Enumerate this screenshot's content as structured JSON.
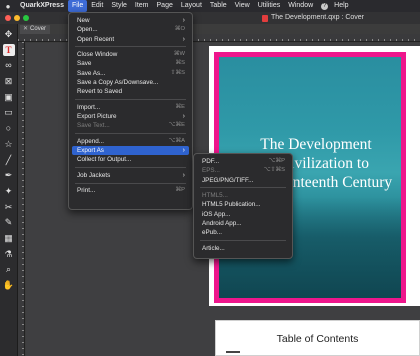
{
  "menubar": {
    "app_name": "QuarkXPress",
    "items": [
      "File",
      "Edit",
      "Style",
      "Item",
      "Page",
      "Layout",
      "Table",
      "View",
      "Utilities",
      "Window"
    ],
    "help_label": "Help"
  },
  "window": {
    "title": "The Development.qxp : Cover"
  },
  "layout_tab": {
    "label": "Cover"
  },
  "file_menu": [
    {
      "label": "New",
      "submenu": true
    },
    {
      "label": "Open...",
      "shortcut": "⌘O"
    },
    {
      "label": "Open Recent",
      "submenu": true
    },
    {
      "separator": true
    },
    {
      "label": "Close Window",
      "shortcut": "⌘W"
    },
    {
      "label": "Save",
      "shortcut": "⌘S"
    },
    {
      "label": "Save As...",
      "shortcut": "⇧⌘S"
    },
    {
      "label": "Save a Copy As/Downsave..."
    },
    {
      "label": "Revert to Saved"
    },
    {
      "separator": true
    },
    {
      "label": "Import...",
      "shortcut": "⌘E"
    },
    {
      "label": "Export Picture",
      "submenu": true
    },
    {
      "label": "Save Text...",
      "shortcut": "⌥⌘E",
      "disabled": true
    },
    {
      "separator": true
    },
    {
      "label": "Append...",
      "shortcut": "⌥⌘A"
    },
    {
      "label": "Export As",
      "submenu": true,
      "highlighted": true
    },
    {
      "label": "Collect for Output..."
    },
    {
      "separator": true
    },
    {
      "label": "Job Jackets",
      "submenu": true
    },
    {
      "separator": true
    },
    {
      "label": "Print...",
      "shortcut": "⌘P"
    }
  ],
  "export_submenu": [
    {
      "label": "PDF...",
      "shortcut": "⌥⌘P"
    },
    {
      "label": "EPS...",
      "shortcut": "⌥⇧⌘S",
      "disabled": true
    },
    {
      "label": "JPEG/PNG/TIFF..."
    },
    {
      "separator": true
    },
    {
      "label": "HTML5...",
      "disabled": true
    },
    {
      "label": "HTML5 Publication..."
    },
    {
      "label": "iOS App..."
    },
    {
      "label": "Android App..."
    },
    {
      "label": "ePub..."
    },
    {
      "separator": true
    },
    {
      "label": "Article..."
    }
  ],
  "cover": {
    "title_lines": [
      "The Development",
      "of Civilization to",
      "the Seventeenth Century"
    ]
  },
  "page2": {
    "heading": "Table of Contents"
  },
  "colors": {
    "accent": "#2f63cf",
    "cover_border": "#ee168c",
    "cover_sea": "#2f99a8"
  }
}
